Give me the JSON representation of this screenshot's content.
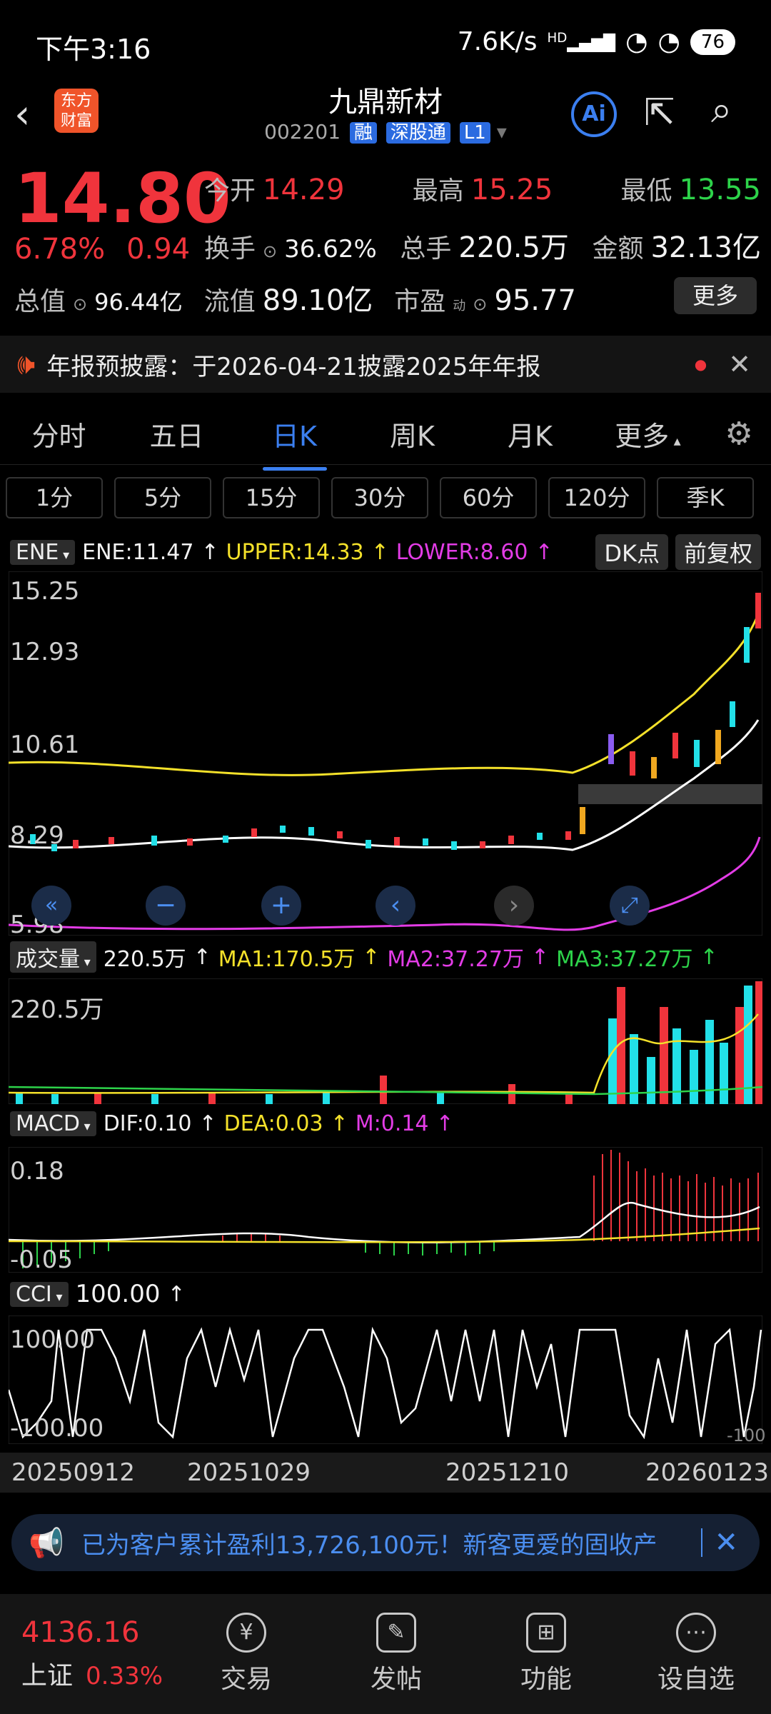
{
  "status": {
    "time": "下午3:16",
    "speed": "7.6K/s",
    "signal": "HD",
    "battery": "76"
  },
  "header": {
    "title": "九鼎新材",
    "code": "002201",
    "tag_rong": "融",
    "tag_sgt": "深股通",
    "tag_l1": "L1",
    "logo_line1": "东方",
    "logo_line2": "财富",
    "ai_label": "Ai"
  },
  "quote": {
    "price": "14.80",
    "change_pct": "6.78%",
    "change": "0.94",
    "open_label": "今开",
    "open": "14.29",
    "high_label": "最高",
    "high": "15.25",
    "low_label": "最低",
    "low": "13.55",
    "turnover_label": "换手",
    "turnover": "36.62%",
    "volume_label": "总手",
    "volume": "220.5万",
    "amount_label": "金额",
    "amount": "32.13亿",
    "mktcap_label": "总值",
    "mktcap": "96.44亿",
    "float_label": "流值",
    "float": "89.10亿",
    "pe_label": "市盈",
    "pe_sup": "动",
    "pe": "95.77",
    "more_label": "更多"
  },
  "notice": {
    "text": "年报预披露：于2026-04-21披露2025年年报"
  },
  "tabs": [
    "分时",
    "五日",
    "日K",
    "周K",
    "月K",
    "更多"
  ],
  "active_tab": "日K",
  "periods": [
    "1分",
    "5分",
    "15分",
    "30分",
    "60分",
    "120分",
    "季K"
  ],
  "main_indicator": {
    "name": "ENE",
    "ene": "ENE:11.47",
    "upper": "UPPER:14.33",
    "lower": "LOWER:8.60",
    "dk_label": "DK点",
    "fq_label": "前复权",
    "axis": [
      "15.25",
      "12.93",
      "10.61",
      "8.29",
      "5.98"
    ]
  },
  "volume_indicator": {
    "name": "成交量",
    "value": "220.5万",
    "ma1": "MA1:170.5万",
    "ma2": "MA2:37.27万",
    "ma3": "MA3:37.27万",
    "axis_top": "220.5万"
  },
  "macd_indicator": {
    "name": "MACD",
    "dif": "DIF:0.10",
    "dea": "DEA:0.03",
    "m": "M:0.14",
    "axis_top": "0.18",
    "axis_bottom": "-0.05"
  },
  "cci_indicator": {
    "name": "CCI",
    "value": "100.00",
    "axis_top": "100.00",
    "axis_bottom": "-100.00",
    "axis_right": "-100"
  },
  "dates": [
    "20250912",
    "20251029",
    "20251210",
    "20260123"
  ],
  "banner": {
    "text": "已为客户累计盈利13,726,100元！新客更爱的固收产"
  },
  "bottom_nav": {
    "index_value": "4136.16",
    "index_name": "上证",
    "index_pct": "0.33%",
    "items": [
      "交易",
      "发帖",
      "功能",
      "设自选"
    ]
  },
  "colors": {
    "up": "#f0343c",
    "down": "#2dd34a",
    "accent": "#3b7ff0",
    "upper": "#f4e12a",
    "lower": "#e33ce6",
    "cyan": "#22e0e8"
  }
}
